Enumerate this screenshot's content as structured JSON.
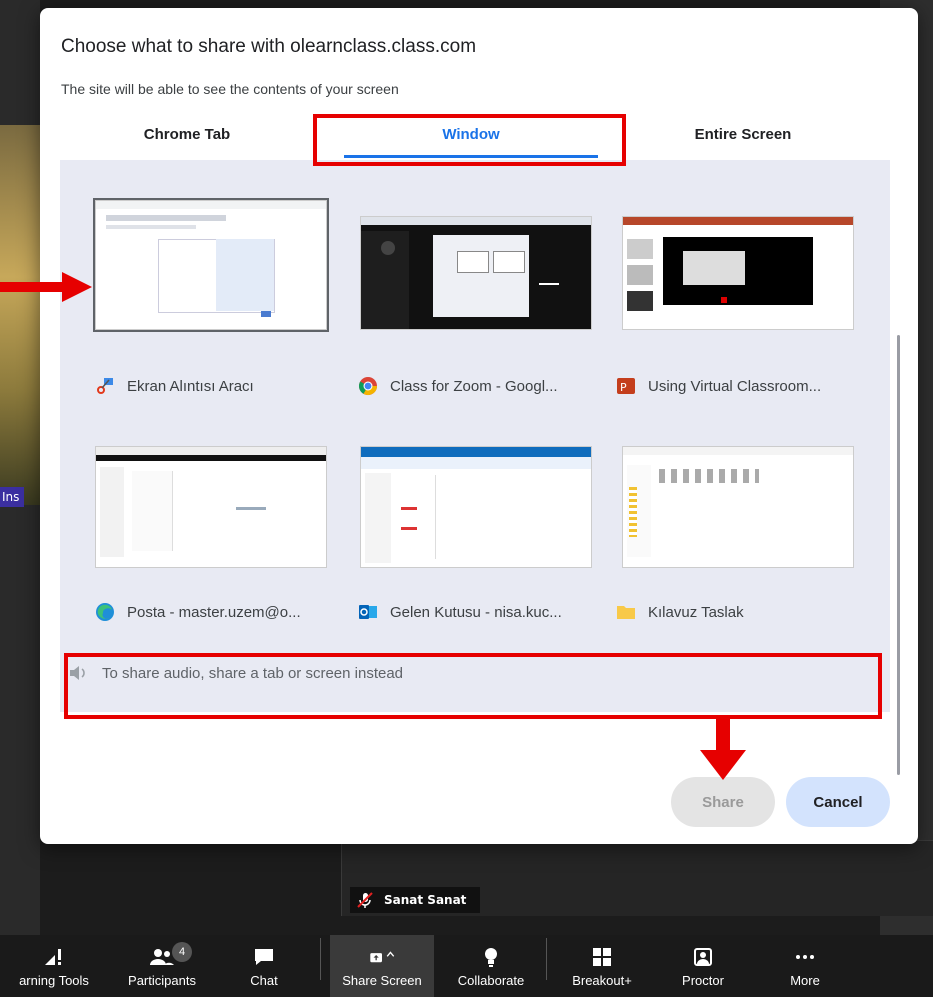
{
  "dialog": {
    "title": "Choose what to share with olearnclass.class.com",
    "subtitle": "The site will be able to see the contents of your screen",
    "tabs": [
      {
        "label": "Chrome Tab",
        "selected": false
      },
      {
        "label": "Window",
        "selected": true
      },
      {
        "label": "Entire Screen",
        "selected": false
      }
    ],
    "windows": [
      {
        "label": "Ekran Alıntısı Aracı",
        "icon": "snipping-tool-icon"
      },
      {
        "label": "Class for Zoom - Googl...",
        "icon": "chrome-icon"
      },
      {
        "label": "Using Virtual Classroom...",
        "icon": "powerpoint-icon"
      },
      {
        "label": "Posta - master.uzem@o...",
        "icon": "edge-icon"
      },
      {
        "label": "Gelen Kutusu - nisa.kuc...",
        "icon": "outlook-icon"
      },
      {
        "label": "Kılavuz Taslak",
        "icon": "folder-icon"
      }
    ],
    "audio_note": "To share audio, share a tab or screen instead",
    "share_label": "Share",
    "cancel_label": "Cancel"
  },
  "meeting": {
    "participant_name": "Sanat Sanat",
    "left_tile_label": "Ins",
    "participants_count": "4"
  },
  "toolbar": {
    "items": [
      {
        "label": "arning Tools",
        "icon": "learning-tools-icon"
      },
      {
        "label": "Participants",
        "icon": "participants-icon"
      },
      {
        "label": "Chat",
        "icon": "chat-icon"
      },
      {
        "label": "Share Screen",
        "icon": "share-screen-icon"
      },
      {
        "label": "Collaborate",
        "icon": "lightbulb-icon"
      },
      {
        "label": "Breakout+",
        "icon": "breakout-icon"
      },
      {
        "label": "Proctor",
        "icon": "proctor-icon"
      },
      {
        "label": "More",
        "icon": "more-icon"
      }
    ]
  },
  "colors": {
    "accent": "#1a73e8",
    "annotation": "#e60000",
    "panel": "#e8eaf3"
  }
}
